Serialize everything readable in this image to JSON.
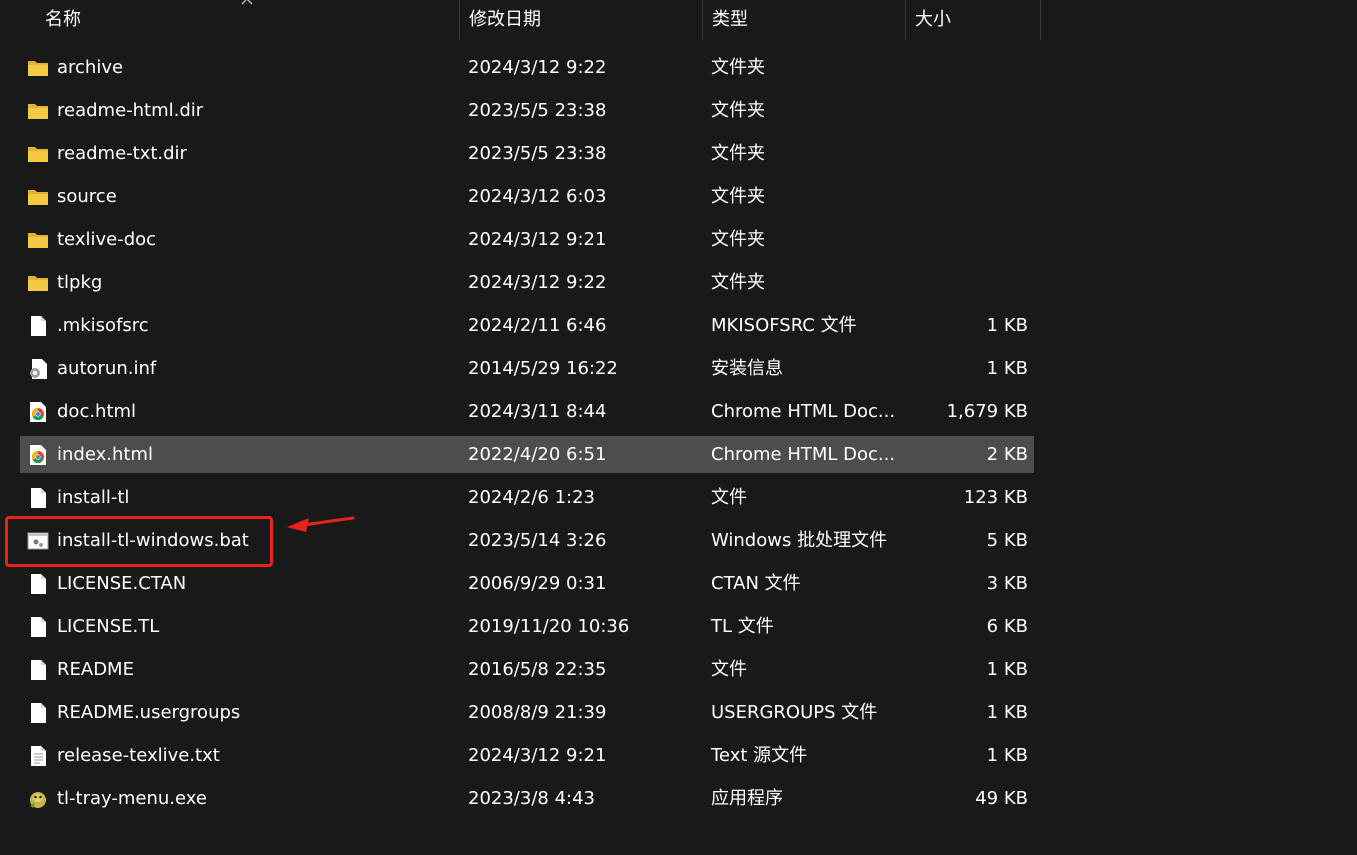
{
  "columns": {
    "name": "名称",
    "date": "修改日期",
    "type": "类型",
    "size": "大小"
  },
  "files": [
    {
      "name": "archive",
      "date": "2024/3/12 9:22",
      "type": "文件夹",
      "size": "",
      "icon": "folder-icon"
    },
    {
      "name": "readme-html.dir",
      "date": "2023/5/5 23:38",
      "type": "文件夹",
      "size": "",
      "icon": "folder-icon"
    },
    {
      "name": "readme-txt.dir",
      "date": "2023/5/5 23:38",
      "type": "文件夹",
      "size": "",
      "icon": "folder-icon"
    },
    {
      "name": "source",
      "date": "2024/3/12 6:03",
      "type": "文件夹",
      "size": "",
      "icon": "folder-icon"
    },
    {
      "name": "texlive-doc",
      "date": "2024/3/12 9:21",
      "type": "文件夹",
      "size": "",
      "icon": "folder-icon"
    },
    {
      "name": "tlpkg",
      "date": "2024/3/12 9:22",
      "type": "文件夹",
      "size": "",
      "icon": "folder-icon"
    },
    {
      "name": ".mkisofsrc",
      "date": "2024/2/11 6:46",
      "type": "MKISOFSRC 文件",
      "size": "1 KB",
      "icon": "file-icon"
    },
    {
      "name": "autorun.inf",
      "date": "2014/5/29 16:22",
      "type": "安装信息",
      "size": "1 KB",
      "icon": "setup-info-icon"
    },
    {
      "name": "doc.html",
      "date": "2024/3/11 8:44",
      "type": "Chrome HTML Doc...",
      "size": "1,679 KB",
      "icon": "chrome-html-icon"
    },
    {
      "name": "index.html",
      "date": "2022/4/20 6:51",
      "type": "Chrome HTML Doc...",
      "size": "2 KB",
      "icon": "chrome-html-icon"
    },
    {
      "name": "install-tl",
      "date": "2024/2/6 1:23",
      "type": "文件",
      "size": "123 KB",
      "icon": "file-icon"
    },
    {
      "name": "install-tl-windows.bat",
      "date": "2023/5/14 3:26",
      "type": "Windows 批处理文件",
      "size": "5 KB",
      "icon": "batch-file-icon"
    },
    {
      "name": "LICENSE.CTAN",
      "date": "2006/9/29 0:31",
      "type": "CTAN 文件",
      "size": "3 KB",
      "icon": "file-icon"
    },
    {
      "name": "LICENSE.TL",
      "date": "2019/11/20 10:36",
      "type": "TL 文件",
      "size": "6 KB",
      "icon": "file-icon"
    },
    {
      "name": "README",
      "date": "2016/5/8 22:35",
      "type": "文件",
      "size": "1 KB",
      "icon": "file-icon"
    },
    {
      "name": "README.usergroups",
      "date": "2008/8/9 21:39",
      "type": "USERGROUPS 文件",
      "size": "1 KB",
      "icon": "file-icon"
    },
    {
      "name": "release-texlive.txt",
      "date": "2024/3/12 9:21",
      "type": "Text 源文件",
      "size": "1 KB",
      "icon": "text-file-icon"
    },
    {
      "name": "tl-tray-menu.exe",
      "date": "2023/3/8 4:43",
      "type": "应用程序",
      "size": "49 KB",
      "icon": "tl-tray-app-icon"
    }
  ],
  "selected_index": 9,
  "annotation_index": 11,
  "colors": {
    "background": "#191919",
    "selected_row": "#4d4d4d",
    "annotation_red": "#e8231b",
    "folder": "#f4c542"
  }
}
